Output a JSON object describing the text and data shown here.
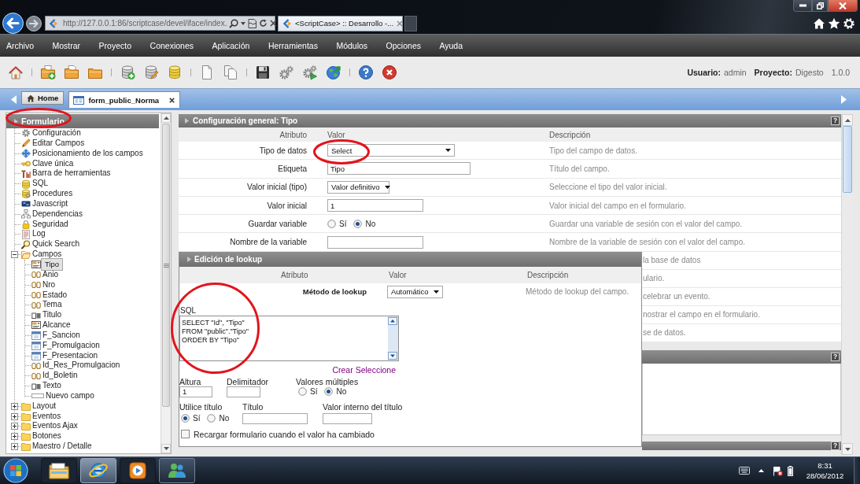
{
  "browser": {
    "address": "http://127.0.0.1:86/scriptcase/devel/iface/index.",
    "tab_title": "<ScriptCase> :: Desarrollo -..."
  },
  "menu": [
    "Archivo",
    "Mostrar",
    "Proyecto",
    "Conexiones",
    "Aplicación",
    "Herramientas",
    "Módulos",
    "Opciones",
    "Ayuda"
  ],
  "user_info": {
    "user_label": "Usuario:",
    "user": "admin",
    "project_label": "Proyecto:",
    "project": "Digesto",
    "version": "1.0.0"
  },
  "tabs": [
    {
      "kind": "home",
      "label": "Home",
      "selected": false
    },
    {
      "kind": "form",
      "label": "form_public_Norma",
      "selected": true
    }
  ],
  "sidebar": {
    "title": "Formulario",
    "items": [
      {
        "label": "Configuración",
        "selected": false
      },
      {
        "label": "Editar Campos",
        "selected": false
      },
      {
        "label": "Posicionamiento de los campos",
        "selected": false
      },
      {
        "label": "Clave única",
        "selected": false
      },
      {
        "label": "Barra de herramientas",
        "selected": false
      },
      {
        "label": "SQL",
        "selected": false
      },
      {
        "label": "Procedures",
        "selected": false
      },
      {
        "label": "Javascript",
        "selected": false
      },
      {
        "label": "Dependencias",
        "selected": false
      },
      {
        "label": "Seguridad",
        "selected": false
      },
      {
        "label": "Log",
        "selected": false
      },
      {
        "label": "Quick Search",
        "selected": false
      },
      {
        "label": "Campos",
        "selected": false,
        "expanded": true,
        "children": [
          {
            "label": "Tipo",
            "kind": "select",
            "selected": true
          },
          {
            "label": "Anio",
            "kind": "number",
            "selected": false
          },
          {
            "label": "Nro",
            "kind": "number",
            "selected": false
          },
          {
            "label": "Estado",
            "kind": "number",
            "selected": false
          },
          {
            "label": "Tema",
            "kind": "number",
            "selected": false
          },
          {
            "label": "Titulo",
            "kind": "text",
            "selected": false
          },
          {
            "label": "Alcance",
            "kind": "select",
            "selected": false
          },
          {
            "label": "F_Sancion",
            "kind": "date",
            "selected": false
          },
          {
            "label": "F_Promulgacion",
            "kind": "date",
            "selected": false
          },
          {
            "label": "F_Presentacion",
            "kind": "date",
            "selected": false
          },
          {
            "label": "Id_Res_Promulgacion",
            "kind": "number",
            "selected": false
          },
          {
            "label": "Id_Boletin",
            "kind": "number",
            "selected": false
          },
          {
            "label": "Texto",
            "kind": "text",
            "selected": false
          },
          {
            "label": "Nuevo campo",
            "kind": "new",
            "selected": false
          }
        ]
      },
      {
        "label": "Layout",
        "selected": false,
        "expanded": false
      },
      {
        "label": "Eventos",
        "selected": false,
        "expanded": false
      },
      {
        "label": "Eventos Ajax",
        "selected": false,
        "expanded": false
      },
      {
        "label": "Botones",
        "selected": false,
        "expanded": false
      },
      {
        "label": "Maestro / Detalle",
        "selected": false,
        "expanded": false
      }
    ]
  },
  "config_panel": {
    "title": "Configuración general: Tipo",
    "help": "?",
    "columns": [
      "Atributo",
      "Valor",
      "Descripción"
    ],
    "rows": [
      {
        "label": "Tipo de datos",
        "kind": "select",
        "value": "Select",
        "description": "Tipo del campo de datos."
      },
      {
        "label": "Etiqueta",
        "kind": "text",
        "value": "Tipo",
        "description": "Título del campo."
      },
      {
        "label": "Valor inicial (tipo)",
        "kind": "select",
        "value": "Valor definitivo",
        "description": "Seleccione el tipo del valor inicial."
      },
      {
        "label": "Valor inicial",
        "kind": "text",
        "value": "1",
        "description": "Valor inicial del campo en el formulario."
      },
      {
        "label": "Guardar variable",
        "kind": "radio",
        "options": [
          {
            "label": "Sí",
            "selected": false
          },
          {
            "label": "No",
            "selected": true
          }
        ],
        "description": "Guardar una variable de sesión con el valor del campo."
      },
      {
        "label": "Nombre de la variable",
        "kind": "text",
        "description": "Nombre de la variable de sesión con el valor del campo."
      }
    ],
    "covered_rows": [
      {
        "description": "la base de datos"
      },
      {
        "description": "ulario."
      },
      {
        "description": "celebrar un evento."
      },
      {
        "description": "nostrar el campo en el formulario."
      },
      {
        "description": "se de datos."
      }
    ]
  },
  "lookup_panel": {
    "title": "Edición de lookup",
    "columns": [
      "Atributo",
      "Valor",
      "Descripción"
    ],
    "method": {
      "label": "Método de lookup",
      "value": "Automático",
      "description": "Método de lookup del campo."
    },
    "sql": {
      "label": "SQL",
      "value": "SELECT \"Id\", \"Tipo\"\nFROM \"public\".\"Tipo\"\nORDER BY \"Tipo\""
    },
    "link": "Crear Seleccione",
    "option_rows": [
      [
        {
          "kind": "text",
          "label": "Altura",
          "value": "1"
        },
        {
          "kind": "text",
          "label": "Delimitador"
        },
        {
          "kind": "radio",
          "label": "Valores múltiples",
          "options": [
            {
              "label": "Sí",
              "selected": false
            },
            {
              "label": "No",
              "selected": true
            }
          ]
        }
      ],
      [
        {
          "kind": "radio",
          "label": "Utilice título",
          "options": [
            {
              "label": "Sí",
              "selected": true
            },
            {
              "label": "No",
              "selected": false
            }
          ]
        },
        {
          "kind": "text",
          "label": "Título"
        },
        {
          "kind": "text",
          "label": "Valor interno del título"
        }
      ]
    ],
    "reload": {
      "label": "Recargar formulario cuando el valor ha cambiado",
      "checked": false
    }
  },
  "more_panels": [
    {
      "help": "?"
    },
    {
      "help": "?"
    }
  ],
  "taskbar": {
    "apps": [
      {
        "kind": "files",
        "running": false,
        "selected": false
      },
      {
        "kind": "browser",
        "running": true,
        "selected": true
      },
      {
        "kind": "media",
        "running": false,
        "selected": false
      },
      {
        "kind": "chat",
        "running": true,
        "selected": false
      }
    ],
    "time": "8:31",
    "date": "28/06/2012"
  }
}
